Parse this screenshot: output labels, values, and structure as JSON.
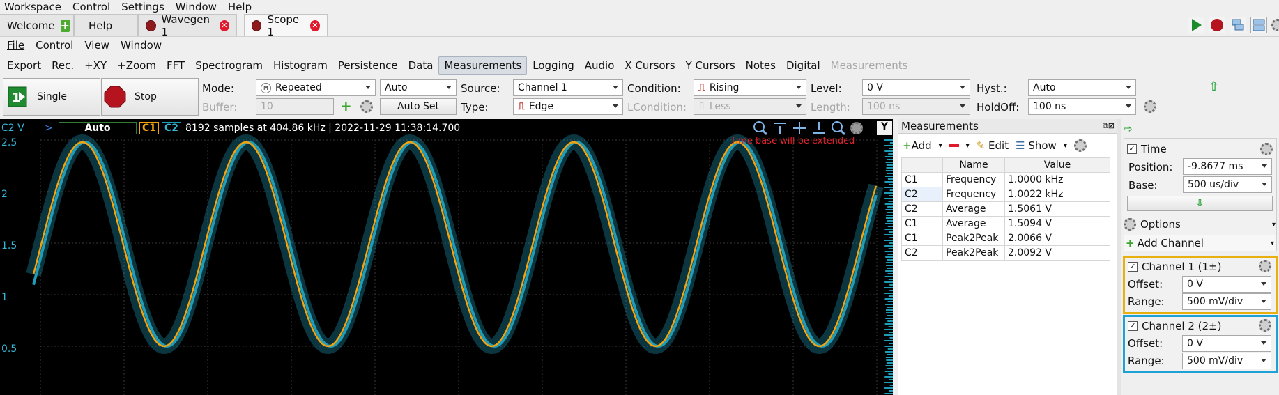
{
  "app_menu": [
    "Workspace",
    "Control",
    "Settings",
    "Window",
    "Help"
  ],
  "tabs": [
    {
      "label": "Welcome"
    },
    {
      "label": "Help"
    },
    {
      "label": "Wavegen 1"
    },
    {
      "label": "Scope 1"
    }
  ],
  "sub_menu": [
    "File",
    "Control",
    "View",
    "Window"
  ],
  "toolbar": [
    "Export",
    "Rec.",
    "+XY",
    "+Zoom",
    "FFT",
    "Spectrogram",
    "Histogram",
    "Persistence",
    "Data",
    "Measurements",
    "Logging",
    "Audio",
    "X Cursors",
    "Y Cursors",
    "Notes",
    "Digital",
    "Measurements"
  ],
  "controls": {
    "single_label": "Single",
    "stop_label": "Stop",
    "mode_label": "Mode:",
    "mode_value": "Repeated",
    "mode2_value": "Auto",
    "buffer_label": "Buffer:",
    "buffer_value": "10",
    "autoset_label": "Auto Set",
    "source_label": "Source:",
    "source_value": "Channel 1",
    "type_label": "Type:",
    "type_value": "Edge",
    "condition_label": "Condition:",
    "condition_value": "Rising",
    "lcondition_label": "LCondition:",
    "lcondition_value": "Less",
    "level_label": "Level:",
    "level_value": "0 V",
    "length_label": "Length:",
    "length_value": "100 ns",
    "hyst_label": "Hyst.:",
    "hyst_value": "Auto",
    "holdoff_label": "HoldOff:",
    "holdoff_value": "100 ns"
  },
  "plot": {
    "channel_label": "C2 V",
    "trigger_status": "Auto",
    "c1": "C1",
    "c2": "C2",
    "info": "8192 samples at 404.86 kHz | 2022-11-29 11:38:14.700",
    "warning": "Time base will be extended",
    "y_button": "Y",
    "y_ticks": [
      "2.5",
      "2",
      "1.5",
      "1",
      "0.5"
    ],
    "colors": {
      "c1": "#f2a20f",
      "c2": "#1f9cb8",
      "warning": "#e0202a"
    }
  },
  "measurements": {
    "title": "Measurements",
    "add_label": "Add",
    "edit_label": "Edit",
    "show_label": "Show",
    "columns": [
      "Name",
      "Value"
    ],
    "rows": [
      {
        "ch": "C1",
        "name": "Frequency",
        "value": "1.0000 kHz"
      },
      {
        "ch": "C2",
        "name": "Frequency",
        "value": "1.0022 kHz"
      },
      {
        "ch": "C2",
        "name": "Average",
        "value": "1.5061 V"
      },
      {
        "ch": "C1",
        "name": "Average",
        "value": "1.5094 V"
      },
      {
        "ch": "C1",
        "name": "Peak2Peak",
        "value": "2.0066 V"
      },
      {
        "ch": "C2",
        "name": "Peak2Peak",
        "value": "2.0092 V"
      }
    ]
  },
  "right_panel": {
    "time_label": "Time",
    "position_label": "Position:",
    "position_value": "-9.8677 ms",
    "base_label": "Base:",
    "base_value": "500 us/div",
    "options_label": "Options",
    "add_channel_label": "Add Channel",
    "ch1_label": "Channel 1 (1±)",
    "ch1_offset_label": "Offset:",
    "ch1_offset_value": "0 V",
    "ch1_range_label": "Range:",
    "ch1_range_value": "500 mV/div",
    "ch2_label": "Channel 2 (2±)",
    "ch2_offset_label": "Offset:",
    "ch2_offset_value": "0 V",
    "ch2_range_label": "Range:",
    "ch2_range_value": "500 mV/div"
  }
}
